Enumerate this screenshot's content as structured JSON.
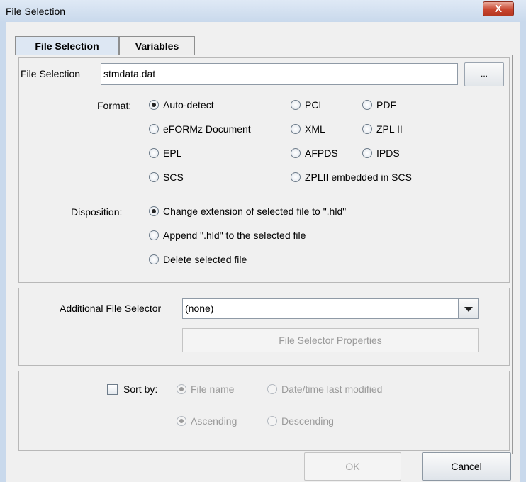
{
  "window": {
    "title": "File Selection",
    "close_label": "X"
  },
  "tabs": [
    {
      "label": "File Selection",
      "active": true
    },
    {
      "label": "Variables",
      "active": false
    }
  ],
  "file_selection": {
    "label": "File Selection",
    "value": "stmdata.dat",
    "browse_label": "..."
  },
  "format": {
    "label": "Format:",
    "selected": "Auto-detect",
    "options": [
      "Auto-detect",
      "PCL",
      "PDF",
      "eFORMz Document",
      "XML",
      "ZPL II",
      "EPL",
      "AFPDS",
      "IPDS",
      "SCS",
      "ZPLII embedded in SCS"
    ]
  },
  "disposition": {
    "label": "Disposition:",
    "selected": "Change extension of selected file to \".hld\"",
    "options": [
      "Change extension of selected file to \".hld\"",
      "Append \".hld\" to the selected file",
      "Delete selected file"
    ]
  },
  "additional": {
    "label": "Additional File Selector",
    "value": "(none)",
    "properties_label": "File Selector Properties"
  },
  "sort": {
    "label": "Sort by:",
    "checked": false,
    "field_options": [
      "File name",
      "Date/time last modified"
    ],
    "field_selected": "File name",
    "order_options": [
      "Ascending",
      "Descending"
    ],
    "order_selected": "Ascending"
  },
  "buttons": {
    "ok": "OK",
    "cancel": "Cancel"
  }
}
